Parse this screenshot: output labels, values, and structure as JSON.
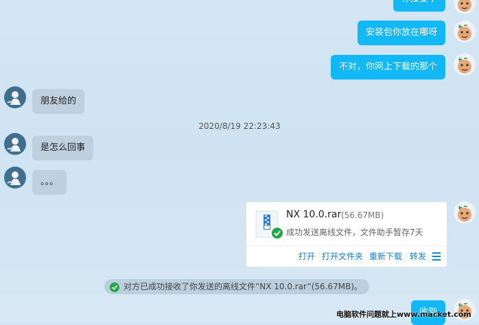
{
  "messages": {
    "m1": "你接受下",
    "m2": "安装包你放在哪呀",
    "m3": "不对，你网上下载的那个",
    "m4": "朋友给的",
    "m5": "是怎么回事",
    "m6": "。。。",
    "m7": "收到"
  },
  "timestamp": "2020/8/19 22:23:43",
  "file": {
    "name": "NX 10.0.rar",
    "size": "(56.67MB)",
    "status": "成功发送离线文件，文件助手暂存7天",
    "actions": {
      "open": "打开",
      "open_folder": "打开文件夹",
      "redownload": "重新下载",
      "forward": "转发"
    }
  },
  "notice": "对方已成功接收了你发送的离线文件“NX 10.0.rar”(56.67MB)。",
  "watermark": "电脑软件问题就上www.macket.com",
  "colors": {
    "my_bubble": "#12b7f5",
    "their_bubble": "#bfd1df",
    "link": "#1281d6",
    "success": "#22a845"
  },
  "icons": [
    "contact-avatar",
    "self-avatar",
    "zip-file-icon",
    "check-icon",
    "menu-icon"
  ]
}
